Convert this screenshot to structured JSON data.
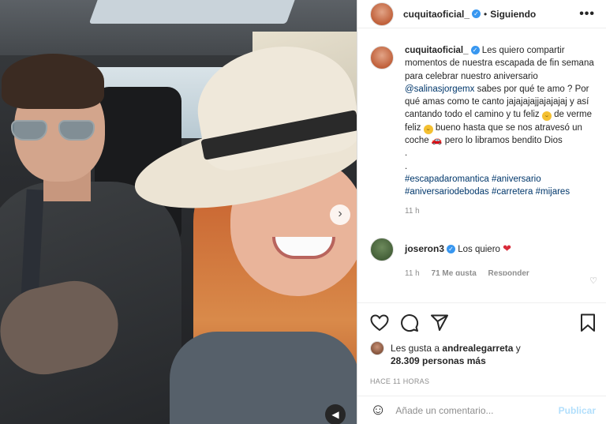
{
  "post": {
    "username": "cuquitaoficial_",
    "follow_status": "Siguiendo",
    "more_label": "•••",
    "verified_mark": "✓"
  },
  "caption": {
    "username": "cuquitaoficial_",
    "text_1": " Les quiero compartir momentos de nuestra escapada de fin semana para celebrar nuestro aniversario ",
    "mention": "@salinasjorgemx",
    "text_2": " sabes por qué te amo ? Por qué amas como te canto jajajajajjajajajaj y así cantando todo el camino y tu feliz ",
    "text_3": " de verme feliz ",
    "text_4": " bueno hasta que se nos atravesó un coche ",
    "text_5": " pero lo libramos bendito Dios",
    "dots": ".\n.",
    "hashtags": [
      "#escapadaromantica",
      "#aniversario",
      "#aniversariodebodas",
      "#carretera",
      "#mijares"
    ],
    "time": "11 h"
  },
  "reply": {
    "username": "joseron3",
    "text": "Los quiero",
    "heart": "❤",
    "time": "11 h",
    "likes": "71 Me gusta",
    "reply_label": "Responder"
  },
  "likes": {
    "prefix": "Les gusta a ",
    "user": "andrealegarreta",
    "connector": " y",
    "count": "28.309 personas más"
  },
  "post_time": "HACE 11 HORAS",
  "comment_box": {
    "placeholder": "Añade un comentario...",
    "publish_label": "Publicar"
  },
  "icons": {
    "next": "›",
    "sound": "◀",
    "heart": "heart-icon",
    "comment": "comment-icon",
    "share": "share-icon",
    "save": "bookmark-icon",
    "emoji": "☺"
  },
  "colors": {
    "link": "#00376b",
    "verified": "#3897f0",
    "publish_disabled": "#b2dffc"
  }
}
